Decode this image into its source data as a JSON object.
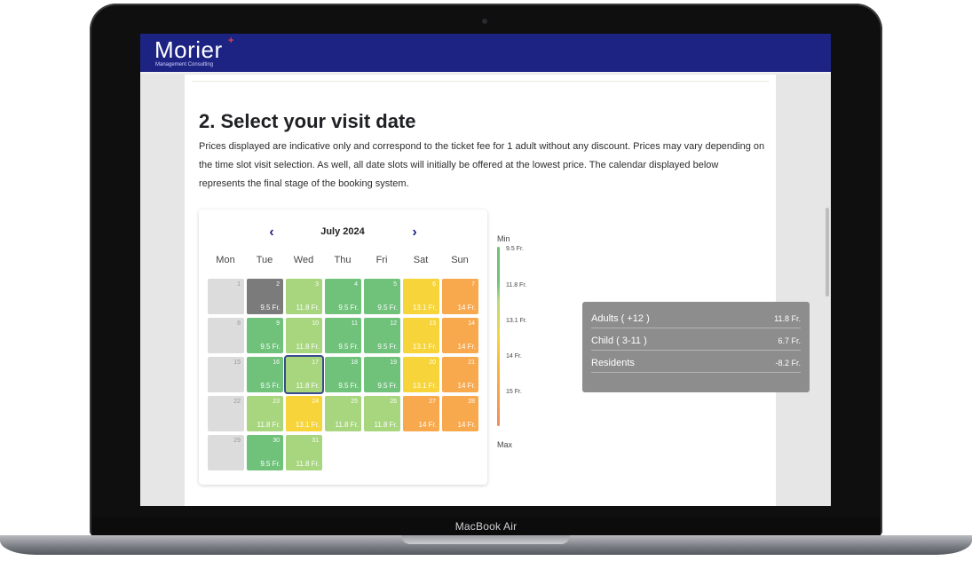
{
  "device": {
    "label": "MacBook Air"
  },
  "header": {
    "brand": "Morier",
    "brand_mark": "+",
    "tagline": "Management Consulting"
  },
  "section": {
    "title": "2. Select your visit date",
    "description": "Prices displayed are indicative only and correspond to the ticket fee for 1 adult without any discount. Prices may vary depending on the time slot visit selection. As well, all date slots will initially be offered at the lowest price. The calendar displayed below represents the final stage of the booking system."
  },
  "calendar": {
    "month_label": "July 2024",
    "weekdays": [
      "Mon",
      "Tue",
      "Wed",
      "Thu",
      "Fri",
      "Sat",
      "Sun"
    ],
    "selected_day": 17,
    "colors": {
      "green": "#70c27b",
      "light_green": "#a8d67f",
      "yellow": "#f7d43a",
      "orange": "#f8a94e",
      "gray": "#7b7b7b",
      "disabled": "#dcdcdc"
    },
    "weeks": [
      [
        {
          "day": "1",
          "price": "",
          "tone": "disabled"
        },
        {
          "day": "2",
          "price": "9.5 Fr.",
          "tone": "gray"
        },
        {
          "day": "3",
          "price": "11.8 Fr.",
          "tone": "light_green"
        },
        {
          "day": "4",
          "price": "9.5 Fr.",
          "tone": "green"
        },
        {
          "day": "5",
          "price": "9.5 Fr.",
          "tone": "green"
        },
        {
          "day": "6",
          "price": "13.1 Fr.",
          "tone": "yellow"
        },
        {
          "day": "7",
          "price": "14 Fr.",
          "tone": "orange"
        }
      ],
      [
        {
          "day": "8",
          "price": "",
          "tone": "disabled"
        },
        {
          "day": "9",
          "price": "9.5 Fr.",
          "tone": "green"
        },
        {
          "day": "10",
          "price": "11.8 Fr.",
          "tone": "light_green"
        },
        {
          "day": "11",
          "price": "9.5 Fr.",
          "tone": "green"
        },
        {
          "day": "12",
          "price": "9.5 Fr.",
          "tone": "green"
        },
        {
          "day": "13",
          "price": "13.1 Fr.",
          "tone": "yellow"
        },
        {
          "day": "14",
          "price": "14 Fr.",
          "tone": "orange"
        }
      ],
      [
        {
          "day": "15",
          "price": "",
          "tone": "disabled"
        },
        {
          "day": "16",
          "price": "9.5 Fr.",
          "tone": "green"
        },
        {
          "day": "17",
          "price": "11.8 Fr.",
          "tone": "light_green"
        },
        {
          "day": "18",
          "price": "9.5 Fr.",
          "tone": "green"
        },
        {
          "day": "19",
          "price": "9.5 Fr.",
          "tone": "green"
        },
        {
          "day": "20",
          "price": "13.1 Fr.",
          "tone": "yellow"
        },
        {
          "day": "21",
          "price": "14 Fr.",
          "tone": "orange"
        }
      ],
      [
        {
          "day": "22",
          "price": "",
          "tone": "disabled"
        },
        {
          "day": "23",
          "price": "11.8 Fr.",
          "tone": "light_green"
        },
        {
          "day": "24",
          "price": "13.1 Fr.",
          "tone": "yellow"
        },
        {
          "day": "25",
          "price": "11.8 Fr.",
          "tone": "light_green"
        },
        {
          "day": "26",
          "price": "11.8 Fr.",
          "tone": "light_green"
        },
        {
          "day": "27",
          "price": "14 Fr.",
          "tone": "orange"
        },
        {
          "day": "28",
          "price": "14 Fr.",
          "tone": "orange"
        }
      ],
      [
        {
          "day": "29",
          "price": "",
          "tone": "disabled"
        },
        {
          "day": "30",
          "price": "9.5 Fr.",
          "tone": "green"
        },
        {
          "day": "31",
          "price": "11.8 Fr.",
          "tone": "light_green"
        }
      ]
    ]
  },
  "legend": {
    "min_label": "Min",
    "max_label": "Max",
    "ticks": [
      "9.5 Fr.",
      "11.8 Fr.",
      "13.1 Fr.",
      "14 Fr.",
      "15 Fr."
    ]
  },
  "summary": {
    "rows": [
      {
        "label": "Adults ( +12 )",
        "value": "11.8 Fr."
      },
      {
        "label": "Child ( 3-11 )",
        "value": "6.7 Fr."
      },
      {
        "label": "Residents",
        "value": "-8.2 Fr."
      }
    ]
  },
  "icons": {
    "prev": "chevron-left-icon",
    "next": "chevron-right-icon"
  }
}
